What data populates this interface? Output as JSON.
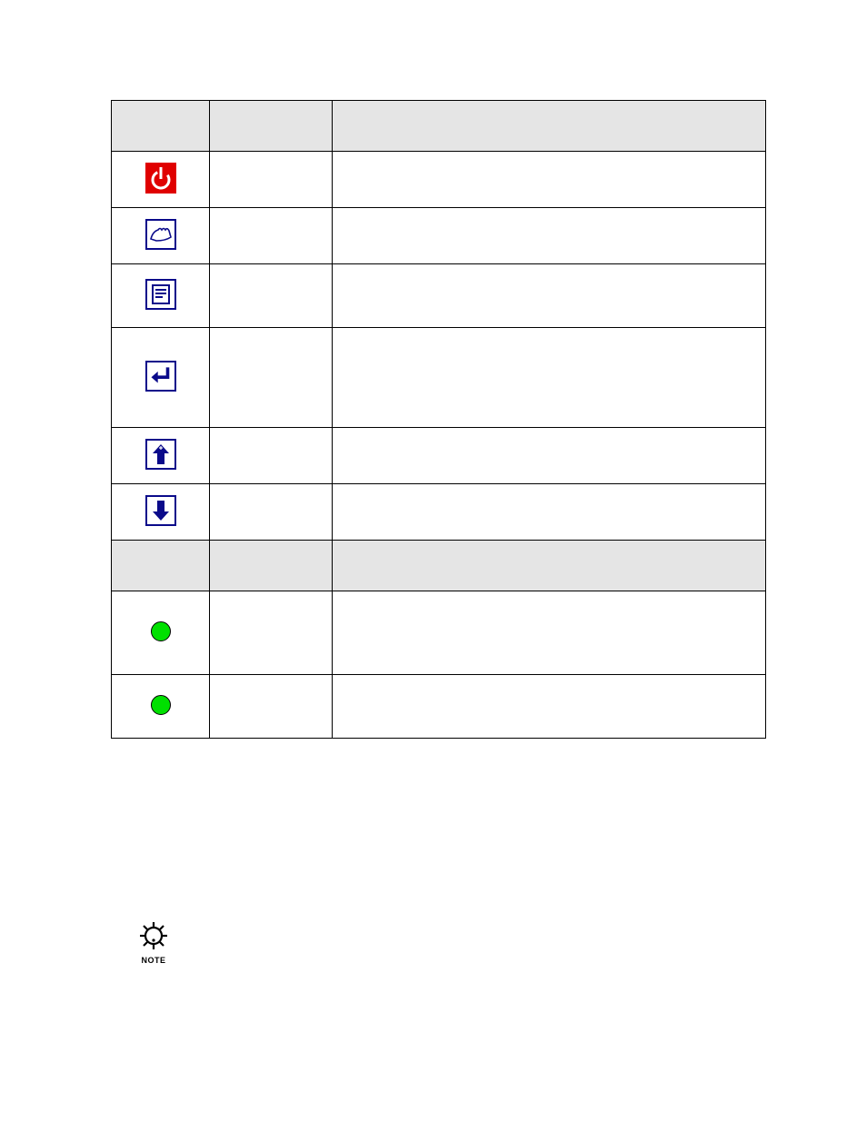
{
  "table": {
    "header1": {
      "c1": "",
      "c2": "",
      "c3": ""
    },
    "rows1": [
      {
        "name": "",
        "desc": ""
      },
      {
        "name": "",
        "desc": ""
      },
      {
        "name": "",
        "desc": ""
      },
      {
        "name": "",
        "desc": ""
      },
      {
        "name": "",
        "desc": ""
      },
      {
        "name": "",
        "desc": ""
      }
    ],
    "header2": {
      "c1": "",
      "c2": "",
      "c3": ""
    },
    "rows2": [
      {
        "name": "",
        "desc": ""
      },
      {
        "name": "",
        "desc": ""
      }
    ]
  },
  "note": {
    "label": "NOTE",
    "text": ""
  },
  "colors": {
    "header_bg": "#e5e5e5",
    "icon_red": "#e00000",
    "icon_blue": "#0a0a8a",
    "led_green": "#00e000"
  }
}
